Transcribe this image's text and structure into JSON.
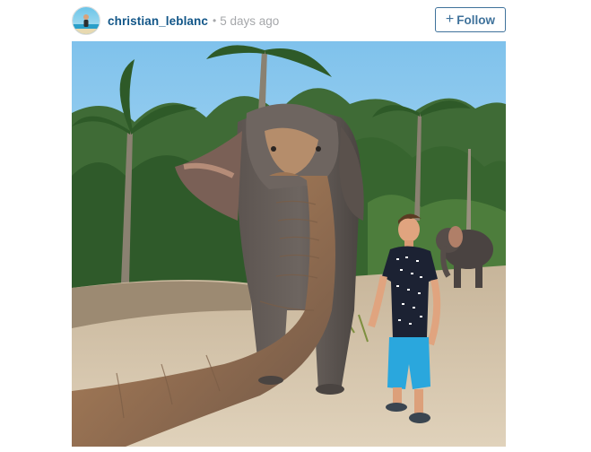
{
  "post": {
    "username": "christian_leblanc",
    "separator": "•",
    "timestamp": "5 days ago",
    "follow_button": {
      "icon": "plus-icon",
      "icon_glyph": "+",
      "label": "Follow"
    },
    "avatar_icon": "user-avatar",
    "photo_icon": "elephant-selfie-photo"
  },
  "colors": {
    "username": "#125688",
    "timestamp": "#a5a7aa",
    "follow_border": "#3f729b",
    "follow_text": "#3f729b"
  }
}
